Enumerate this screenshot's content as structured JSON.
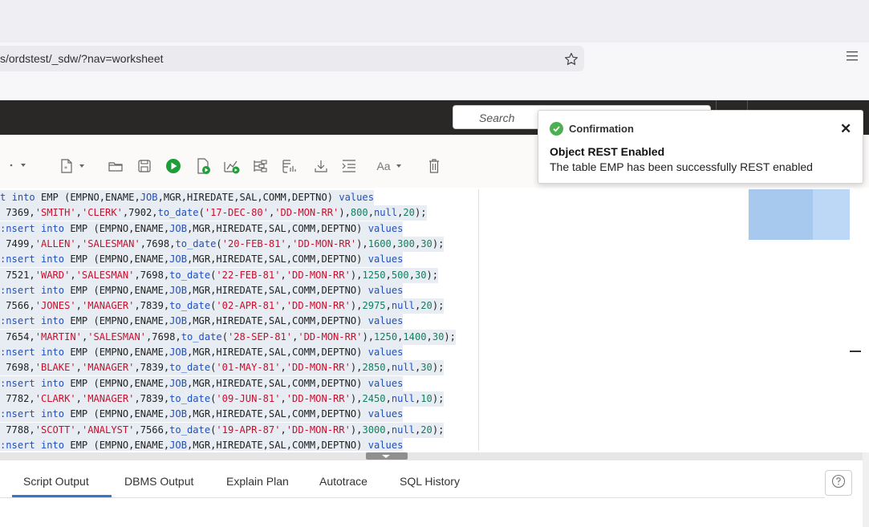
{
  "browser": {
    "url": "s/ordstest/_sdw/?nav=worksheet"
  },
  "header": {
    "search_placeholder": "Search"
  },
  "toolbar": {
    "font_label": "Aa"
  },
  "editor": {
    "lines": [
      [
        [
          "t",
          "kw"
        ],
        [
          " ",
          ""
        ],
        [
          "into",
          "kw"
        ],
        [
          " EMP (EMPNO,ENAME,",
          ""
        ],
        [
          "JOB",
          "fn"
        ],
        [
          ",MGR,HIREDATE,SAL,COMM,DEPTNO) ",
          ""
        ],
        [
          "values",
          "kw"
        ]
      ],
      [
        [
          " 7369",
          ""
        ],
        [
          ",",
          ""
        ],
        [
          "'SMITH'",
          "str"
        ],
        [
          ",",
          ""
        ],
        [
          "'CLERK'",
          "str"
        ],
        [
          ",7902,",
          ""
        ],
        [
          "to_date",
          "fn"
        ],
        [
          "(",
          ""
        ],
        [
          "'17-DEC-80'",
          "str"
        ],
        [
          ",",
          ""
        ],
        [
          "'DD-MON-RR'",
          "str"
        ],
        [
          "),",
          ""
        ],
        [
          "800",
          "num"
        ],
        [
          ",",
          ""
        ],
        [
          "null",
          "kw"
        ],
        [
          ",",
          ""
        ],
        [
          "20",
          "num"
        ],
        [
          ");",
          ""
        ]
      ],
      [
        [
          ":nsert",
          "kw"
        ],
        [
          " ",
          ""
        ],
        [
          "into",
          "kw"
        ],
        [
          " EMP (EMPNO,ENAME,",
          ""
        ],
        [
          "JOB",
          "fn"
        ],
        [
          ",MGR,HIREDATE,SAL,COMM,DEPTNO) ",
          ""
        ],
        [
          "values",
          "kw"
        ]
      ],
      [
        [
          " 7499",
          ""
        ],
        [
          ",",
          ""
        ],
        [
          "'ALLEN'",
          "str"
        ],
        [
          ",",
          ""
        ],
        [
          "'SALESMAN'",
          "str"
        ],
        [
          ",7698,",
          ""
        ],
        [
          "to_date",
          "fn"
        ],
        [
          "(",
          ""
        ],
        [
          "'20-FEB-81'",
          "str"
        ],
        [
          ",",
          ""
        ],
        [
          "'DD-MON-RR'",
          "str"
        ],
        [
          "),",
          ""
        ],
        [
          "1600",
          "num"
        ],
        [
          ",",
          ""
        ],
        [
          "300",
          "num"
        ],
        [
          ",",
          ""
        ],
        [
          "30",
          "num"
        ],
        [
          ");",
          ""
        ]
      ],
      [
        [
          ":nsert",
          "kw"
        ],
        [
          " ",
          ""
        ],
        [
          "into",
          "kw"
        ],
        [
          " EMP (EMPNO,ENAME,",
          ""
        ],
        [
          "JOB",
          "fn"
        ],
        [
          ",MGR,HIREDATE,SAL,COMM,DEPTNO) ",
          ""
        ],
        [
          "values",
          "kw"
        ]
      ],
      [
        [
          " 7521",
          ""
        ],
        [
          ",",
          ""
        ],
        [
          "'WARD'",
          "str"
        ],
        [
          ",",
          ""
        ],
        [
          "'SALESMAN'",
          "str"
        ],
        [
          ",7698,",
          ""
        ],
        [
          "to_date",
          "fn"
        ],
        [
          "(",
          ""
        ],
        [
          "'22-FEB-81'",
          "str"
        ],
        [
          ",",
          ""
        ],
        [
          "'DD-MON-RR'",
          "str"
        ],
        [
          "),",
          ""
        ],
        [
          "1250",
          "num"
        ],
        [
          ",",
          ""
        ],
        [
          "500",
          "num"
        ],
        [
          ",",
          ""
        ],
        [
          "30",
          "num"
        ],
        [
          ");",
          ""
        ]
      ],
      [
        [
          ":nsert",
          "kw"
        ],
        [
          " ",
          ""
        ],
        [
          "into",
          "kw"
        ],
        [
          " EMP (EMPNO,ENAME,",
          ""
        ],
        [
          "JOB",
          "fn"
        ],
        [
          ",MGR,HIREDATE,SAL,COMM,DEPTNO) ",
          ""
        ],
        [
          "values",
          "kw"
        ]
      ],
      [
        [
          " 7566",
          ""
        ],
        [
          ",",
          ""
        ],
        [
          "'JONES'",
          "str"
        ],
        [
          ",",
          ""
        ],
        [
          "'MANAGER'",
          "str"
        ],
        [
          ",7839,",
          ""
        ],
        [
          "to_date",
          "fn"
        ],
        [
          "(",
          ""
        ],
        [
          "'02-APR-81'",
          "str"
        ],
        [
          ",",
          ""
        ],
        [
          "'DD-MON-RR'",
          "str"
        ],
        [
          "),",
          ""
        ],
        [
          "2975",
          "num"
        ],
        [
          ",",
          ""
        ],
        [
          "null",
          "kw"
        ],
        [
          ",",
          ""
        ],
        [
          "20",
          "num"
        ],
        [
          ");",
          ""
        ]
      ],
      [
        [
          ":nsert",
          "kw"
        ],
        [
          " ",
          ""
        ],
        [
          "into",
          "kw"
        ],
        [
          " EMP (EMPNO,ENAME,",
          ""
        ],
        [
          "JOB",
          "fn"
        ],
        [
          ",MGR,HIREDATE,SAL,COMM,DEPTNO) ",
          ""
        ],
        [
          "values",
          "kw"
        ]
      ],
      [
        [
          " 7654",
          ""
        ],
        [
          ",",
          ""
        ],
        [
          "'MARTIN'",
          "str"
        ],
        [
          ",",
          ""
        ],
        [
          "'SALESMAN'",
          "str"
        ],
        [
          ",7698,",
          ""
        ],
        [
          "to_date",
          "fn"
        ],
        [
          "(",
          ""
        ],
        [
          "'28-SEP-81'",
          "str"
        ],
        [
          ",",
          ""
        ],
        [
          "'DD-MON-RR'",
          "str"
        ],
        [
          "),",
          ""
        ],
        [
          "1250",
          "num"
        ],
        [
          ",",
          ""
        ],
        [
          "1400",
          "num"
        ],
        [
          ",",
          ""
        ],
        [
          "30",
          "num"
        ],
        [
          ");",
          ""
        ]
      ],
      [
        [
          ":nsert",
          "kw"
        ],
        [
          " ",
          ""
        ],
        [
          "into",
          "kw"
        ],
        [
          " EMP (EMPNO,ENAME,",
          ""
        ],
        [
          "JOB",
          "fn"
        ],
        [
          ",MGR,HIREDATE,SAL,COMM,DEPTNO) ",
          ""
        ],
        [
          "values",
          "kw"
        ]
      ],
      [
        [
          " 7698",
          ""
        ],
        [
          ",",
          ""
        ],
        [
          "'BLAKE'",
          "str"
        ],
        [
          ",",
          ""
        ],
        [
          "'MANAGER'",
          "str"
        ],
        [
          ",7839,",
          ""
        ],
        [
          "to_date",
          "fn"
        ],
        [
          "(",
          ""
        ],
        [
          "'01-MAY-81'",
          "str"
        ],
        [
          ",",
          ""
        ],
        [
          "'DD-MON-RR'",
          "str"
        ],
        [
          "),",
          ""
        ],
        [
          "2850",
          "num"
        ],
        [
          ",",
          ""
        ],
        [
          "null",
          "kw"
        ],
        [
          ",",
          ""
        ],
        [
          "30",
          "num"
        ],
        [
          ");",
          ""
        ]
      ],
      [
        [
          ":nsert",
          "kw"
        ],
        [
          " ",
          ""
        ],
        [
          "into",
          "kw"
        ],
        [
          " EMP (EMPNO,ENAME,",
          ""
        ],
        [
          "JOB",
          "fn"
        ],
        [
          ",MGR,HIREDATE,SAL,COMM,DEPTNO) ",
          ""
        ],
        [
          "values",
          "kw"
        ]
      ],
      [
        [
          " 7782",
          ""
        ],
        [
          ",",
          ""
        ],
        [
          "'CLARK'",
          "str"
        ],
        [
          ",",
          ""
        ],
        [
          "'MANAGER'",
          "str"
        ],
        [
          ",7839,",
          ""
        ],
        [
          "to_date",
          "fn"
        ],
        [
          "(",
          ""
        ],
        [
          "'09-JUN-81'",
          "str"
        ],
        [
          ",",
          ""
        ],
        [
          "'DD-MON-RR'",
          "str"
        ],
        [
          "),",
          ""
        ],
        [
          "2450",
          "num"
        ],
        [
          ",",
          ""
        ],
        [
          "null",
          "kw"
        ],
        [
          ",",
          ""
        ],
        [
          "10",
          "num"
        ],
        [
          ");",
          ""
        ]
      ],
      [
        [
          ":nsert",
          "kw"
        ],
        [
          " ",
          ""
        ],
        [
          "into",
          "kw"
        ],
        [
          " EMP (EMPNO,ENAME,",
          ""
        ],
        [
          "JOB",
          "fn"
        ],
        [
          ",MGR,HIREDATE,SAL,COMM,DEPTNO) ",
          ""
        ],
        [
          "values",
          "kw"
        ]
      ],
      [
        [
          " 7788",
          ""
        ],
        [
          ",",
          ""
        ],
        [
          "'SCOTT'",
          "str"
        ],
        [
          ",",
          ""
        ],
        [
          "'ANALYST'",
          "str"
        ],
        [
          ",7566,",
          ""
        ],
        [
          "to_date",
          "fn"
        ],
        [
          "(",
          ""
        ],
        [
          "'19-APR-87'",
          "str"
        ],
        [
          ",",
          ""
        ],
        [
          "'DD-MON-RR'",
          "str"
        ],
        [
          "),",
          ""
        ],
        [
          "3000",
          "num"
        ],
        [
          ",",
          ""
        ],
        [
          "null",
          "kw"
        ],
        [
          ",",
          ""
        ],
        [
          "20",
          "num"
        ],
        [
          ");",
          ""
        ]
      ],
      [
        [
          ":nsert",
          "kw"
        ],
        [
          " ",
          ""
        ],
        [
          "into",
          "kw"
        ],
        [
          " EMP (EMPNO,ENAME,",
          ""
        ],
        [
          "JOB",
          "fn"
        ],
        [
          ",MGR,HIREDATE,SAL,COMM,DEPTNO) ",
          ""
        ],
        [
          "values",
          "kw"
        ]
      ]
    ]
  },
  "tabs": [
    {
      "label": "Script Output"
    },
    {
      "label": "DBMS Output"
    },
    {
      "label": "Explain Plan"
    },
    {
      "label": "Autotrace"
    },
    {
      "label": "SQL History"
    }
  ],
  "toast": {
    "title": "Confirmation",
    "close": "✕",
    "heading": "Object REST Enabled",
    "message": "The table EMP has been successfully REST enabled"
  },
  "icons": {
    "star": "star-icon",
    "menu": "hamburger-menu-icon",
    "help": "help-icon",
    "check": "check-circle-icon"
  },
  "colors": {
    "accent": "#3479c7",
    "header": "#2a2826",
    "success": "#4caf50",
    "keyword": "#1f4fbf",
    "string": "#c8102e",
    "number": "#12805c"
  }
}
